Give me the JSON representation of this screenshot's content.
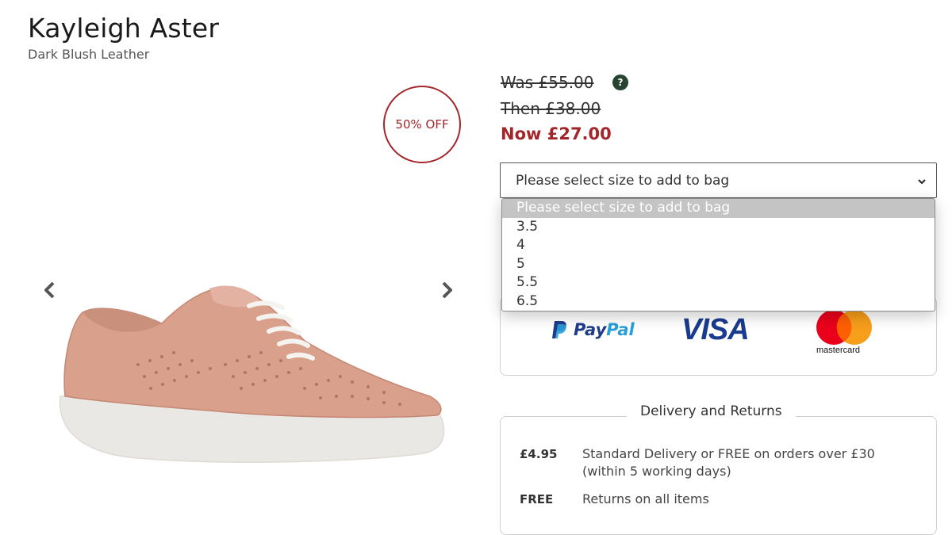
{
  "product": {
    "name": "Kayleigh Aster",
    "variant": "Dark Blush Leather"
  },
  "badge": {
    "text": "50% OFF",
    "color": "#a3262a"
  },
  "pricing": {
    "was": "Was £55.00",
    "then": "Then £38.00",
    "now": "Now £27.00",
    "help_icon": "question-icon"
  },
  "size_select": {
    "value": "Please select size to add to bag",
    "options": [
      "Please select size to add to bag",
      "3.5",
      "4",
      "5",
      "5.5",
      "6.5"
    ]
  },
  "payment": {
    "paypal": {
      "pay": "Pay",
      "pal": "Pal"
    },
    "visa": "VISA",
    "mastercard": "mastercard"
  },
  "delivery": {
    "title": "Delivery and Returns",
    "rows": [
      {
        "label": "£4.95",
        "text": "Standard Delivery or FREE on orders over £30 (within 5 working days)"
      },
      {
        "label": "FREE",
        "text": "Returns on all items"
      }
    ]
  },
  "icons": {
    "prev": "chevron-left-icon",
    "next": "chevron-right-icon",
    "select": "chevron-down-icon"
  },
  "colors": {
    "accent": "#a3262a",
    "help_bg": "#264431",
    "paypal_dark": "#1f3c88",
    "paypal_light": "#2a9fd8",
    "visa": "#1a3c8e",
    "mc_red": "#eb001b",
    "mc_orange": "#f79e1b"
  }
}
